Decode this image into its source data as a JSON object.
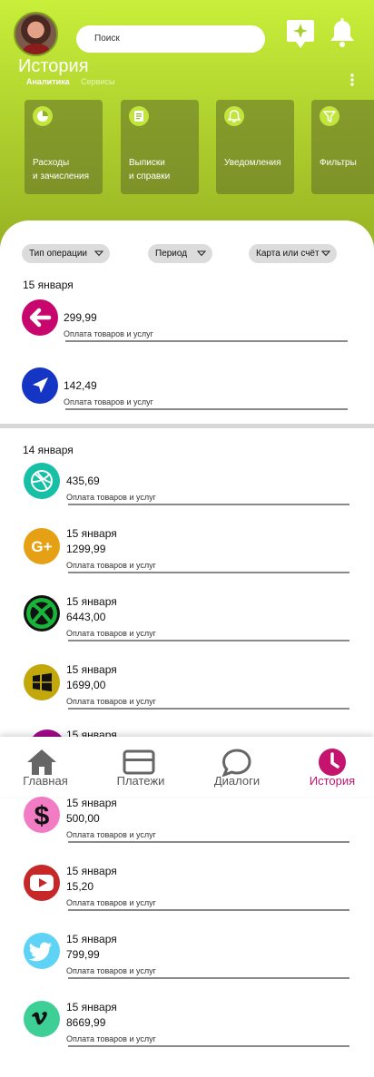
{
  "header": {
    "search_placeholder": "Поиск",
    "title": "История",
    "tabs": [
      "Аналитика",
      "Сервисы"
    ],
    "active_tab": "Аналитика"
  },
  "services": [
    {
      "label": "Расходы\nи зачисления",
      "icon": "pie-chart-icon"
    },
    {
      "label": "Выписки\nи справки",
      "icon": "document-icon"
    },
    {
      "label": "Уведомления",
      "icon": "bell-icon"
    },
    {
      "label": "Фильтры",
      "icon": "filter-icon"
    }
  ],
  "filters": [
    "Тип операции",
    "Период",
    "Карта или счёт"
  ],
  "groups": [
    {
      "date": "15 января"
    },
    {
      "date": "14 января"
    }
  ],
  "transactions": [
    {
      "date": "",
      "amount": "299,99",
      "desc": "Оплата товаров и услуг",
      "icon": "arrow-left-icon",
      "color": "#c7066e"
    },
    {
      "date": "",
      "amount": "142,49",
      "desc": "Оплата товаров и услуг",
      "icon": "navigation-arrow-icon",
      "color": "#1536c4"
    },
    {
      "date": "",
      "amount": "435,69",
      "desc": "Оплата товаров и услуг",
      "icon": "dribbble-icon",
      "color": "#16bfa5"
    },
    {
      "date": "15 января",
      "amount": "1299,99",
      "desc": "Оплата товаров и услуг",
      "icon": "google-plus-icon",
      "color": "#e5a013"
    },
    {
      "date": "15 января",
      "amount": "6443,00",
      "desc": "Оплата товаров и услуг",
      "icon": "xbox-icon",
      "color": "#111111"
    },
    {
      "date": "15 января",
      "amount": "1699,00",
      "desc": "Оплата товаров и услуг",
      "icon": "windows-icon",
      "color": "#c2a80a"
    },
    {
      "date": "15 января",
      "amount": "500,00",
      "desc": "Оплата товаров и услуг",
      "icon": "dollar-icon",
      "color": "#f27cc4"
    },
    {
      "date": "15 января",
      "amount": "15,20",
      "desc": "Оплата товаров и услуг",
      "icon": "youtube-icon",
      "color": "#c62828"
    },
    {
      "date": "15 января",
      "amount": "799,99",
      "desc": "Оплата товаров и услуг",
      "icon": "twitter-icon",
      "color": "#5fd3f6"
    },
    {
      "date": "15 января",
      "amount": "8669,99",
      "desc": "Оплата товаров и услуг",
      "icon": "vimeo-icon",
      "color": "#3ecf97"
    }
  ],
  "partial_item": {
    "date": "15 января"
  },
  "bottom_nav": [
    {
      "label": "Главная",
      "icon": "home-icon"
    },
    {
      "label": "Платежи",
      "icon": "card-icon"
    },
    {
      "label": "Диалоги",
      "icon": "chat-icon"
    },
    {
      "label": "История",
      "icon": "clock-icon",
      "active": true
    }
  ],
  "colors": {
    "accent": "#c4146e",
    "header_top": "#c8ef3a",
    "header_bottom": "#93ad22"
  }
}
